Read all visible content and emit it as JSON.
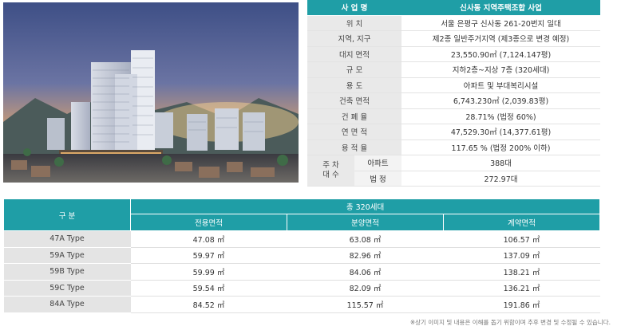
{
  "info_table": {
    "header": {
      "label": "사 업 명",
      "value": "신사동 지역주택조합 사업"
    },
    "rows": [
      {
        "label": "위  치",
        "value": "서울 은평구 신사동 261-20번지 일대"
      },
      {
        "label": "지역, 지구",
        "value": "제2종 일반주거지역 (제3종으로 변경 예정)"
      },
      {
        "label": "대지 면적",
        "value": "23,550.90㎡ (7,124.147평)"
      },
      {
        "label": "규  모",
        "value": "지하2층~지상 7층 (320세대)"
      },
      {
        "label": "용  도",
        "value": "아파트 및 부대복리시설"
      },
      {
        "label": "건축 면적",
        "value": "6,743.230㎡ (2,039.83평)"
      },
      {
        "label": "건 폐 율",
        "value": "28.71% (법정 60%)"
      },
      {
        "label": "연 면 적",
        "value": "47,529.30㎡ (14,377.61평)"
      },
      {
        "label": "용 적 율",
        "value": "117.65 % (법정 200% 이하)"
      }
    ],
    "parking": {
      "label_line1": "주 차",
      "label_line2": "대 수",
      "rows": [
        {
          "label": "아파트",
          "value": "388대"
        },
        {
          "label": "법  정",
          "value": "272.97대"
        }
      ]
    }
  },
  "units_table": {
    "corner_label": "구  분",
    "total_label": "총 320세대",
    "columns": [
      "전용면적",
      "분양면적",
      "계약면적"
    ],
    "rows": [
      {
        "type": "47A Type",
        "exclusive": "47.08 ㎡",
        "sale": "63.08 ㎡",
        "contract": "106.57 ㎡"
      },
      {
        "type": "59A Type",
        "exclusive": "59.97 ㎡",
        "sale": "82.96 ㎡",
        "contract": "137.09 ㎡"
      },
      {
        "type": "59B Type",
        "exclusive": "59.99 ㎡",
        "sale": "84.06 ㎡",
        "contract": "138.21 ㎡"
      },
      {
        "type": "59C Type",
        "exclusive": "59.54 ㎡",
        "sale": "82.09 ㎡",
        "contract": "136.21 ㎡"
      },
      {
        "type": "84A Type",
        "exclusive": "84.52 ㎡",
        "sale": "115.57 ㎡",
        "contract": "191.86 ㎡"
      }
    ]
  },
  "footnote": "※상기 이미지 및 내용은 이해를 돕기 위함이며 추후 변경 및 수정될 수 있습니다.",
  "colors": {
    "accent_teal": "#1f9ea6",
    "label_gray": "#e9e9e9"
  }
}
